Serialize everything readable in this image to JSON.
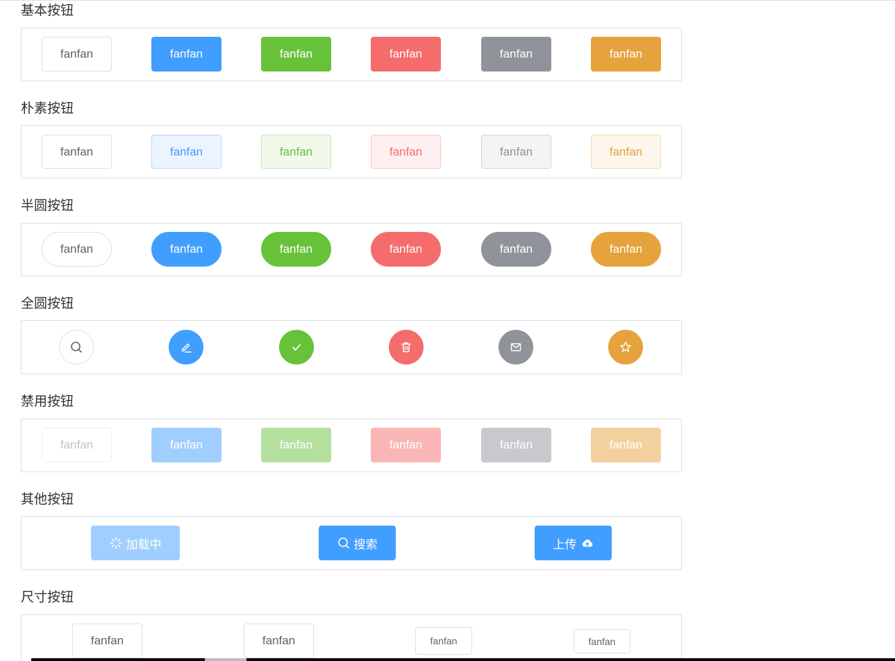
{
  "sections": {
    "basic": {
      "title": "基本按钮",
      "buttons": [
        {
          "label": "fanfan",
          "type": "default"
        },
        {
          "label": "fanfan",
          "type": "primary"
        },
        {
          "label": "fanfan",
          "type": "success"
        },
        {
          "label": "fanfan",
          "type": "danger"
        },
        {
          "label": "fanfan",
          "type": "info"
        },
        {
          "label": "fanfan",
          "type": "warning"
        }
      ]
    },
    "plain": {
      "title": "朴素按钮",
      "buttons": [
        {
          "label": "fanfan",
          "type": "default"
        },
        {
          "label": "fanfan",
          "type": "primary"
        },
        {
          "label": "fanfan",
          "type": "success"
        },
        {
          "label": "fanfan",
          "type": "danger"
        },
        {
          "label": "fanfan",
          "type": "info"
        },
        {
          "label": "fanfan",
          "type": "warning"
        }
      ]
    },
    "round": {
      "title": "半圆按钮",
      "buttons": [
        {
          "label": "fanfan",
          "type": "default"
        },
        {
          "label": "fanfan",
          "type": "primary"
        },
        {
          "label": "fanfan",
          "type": "success"
        },
        {
          "label": "fanfan",
          "type": "danger"
        },
        {
          "label": "fanfan",
          "type": "info"
        },
        {
          "label": "fanfan",
          "type": "warning"
        }
      ]
    },
    "circle": {
      "title": "全圆按钮",
      "buttons": [
        {
          "icon": "search-icon",
          "type": "default"
        },
        {
          "icon": "edit-icon",
          "type": "primary"
        },
        {
          "icon": "check-icon",
          "type": "success"
        },
        {
          "icon": "delete-icon",
          "type": "danger"
        },
        {
          "icon": "message-icon",
          "type": "info"
        },
        {
          "icon": "star-icon",
          "type": "warning"
        }
      ]
    },
    "disabled": {
      "title": "禁用按钮",
      "buttons": [
        {
          "label": "fanfan",
          "type": "default"
        },
        {
          "label": "fanfan",
          "type": "primary"
        },
        {
          "label": "fanfan",
          "type": "success"
        },
        {
          "label": "fanfan",
          "type": "danger"
        },
        {
          "label": "fanfan",
          "type": "info"
        },
        {
          "label": "fanfan",
          "type": "warning"
        }
      ]
    },
    "other": {
      "title": "其他按钮",
      "loading": {
        "label": "加载中",
        "icon": "loading-icon"
      },
      "search": {
        "label": "搜索",
        "icon": "search-icon"
      },
      "upload": {
        "label": "上传",
        "icon": "upload-cloud-icon"
      }
    },
    "size": {
      "title": "尺寸按钮",
      "buttons": [
        {
          "label": "fanfan",
          "size": "default"
        },
        {
          "label": "fanfan",
          "size": "medium"
        },
        {
          "label": "fanfan",
          "size": "small"
        },
        {
          "label": "fanfan",
          "size": "mini"
        }
      ]
    }
  },
  "colors": {
    "primary": "#409eff",
    "success": "#67c23a",
    "danger": "#f56c6c",
    "info": "#909399",
    "warning": "#e6a23c",
    "border": "#dcdfe6",
    "text": "#606266"
  }
}
